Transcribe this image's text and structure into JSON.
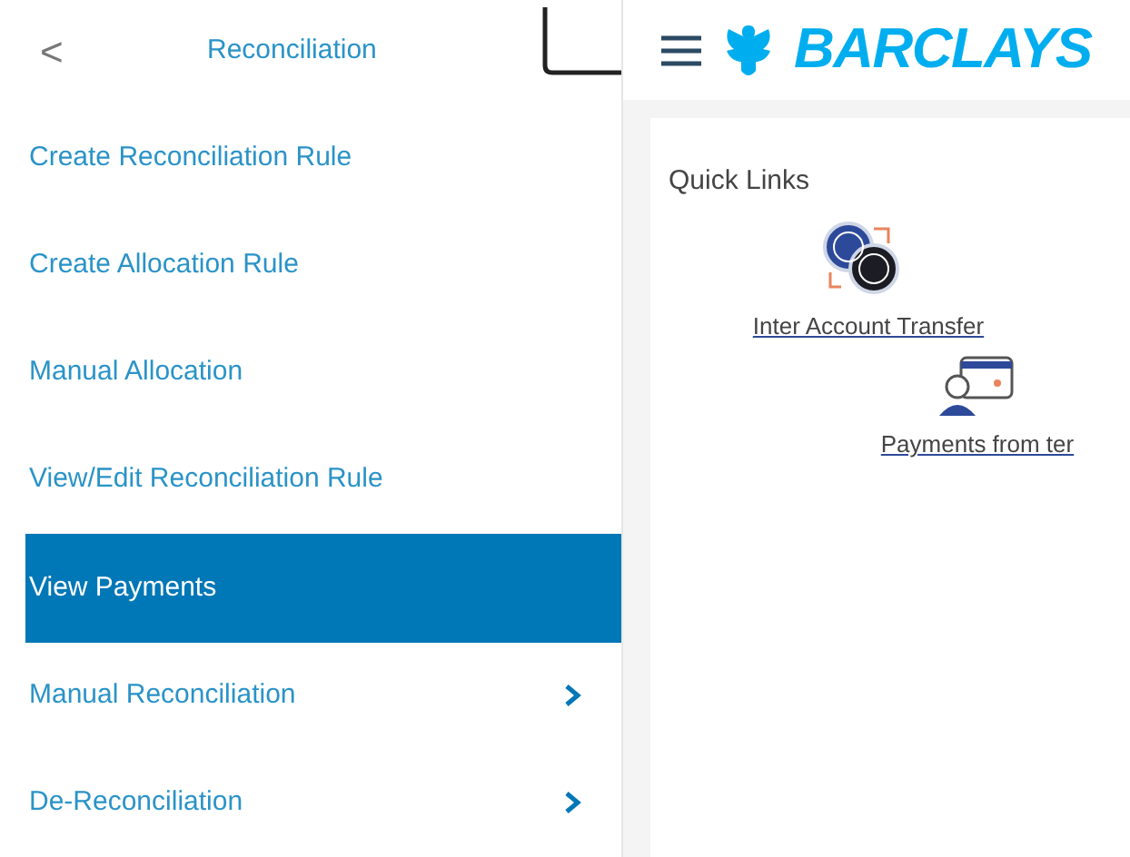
{
  "sidebar": {
    "back": "<",
    "title": "Reconciliation",
    "items": [
      {
        "label": "Create Reconciliation Rule",
        "selected": false,
        "kind": "link"
      },
      {
        "label": "Create Allocation Rule",
        "selected": false,
        "kind": "link"
      },
      {
        "label": "Manual Allocation",
        "selected": false,
        "kind": "link"
      },
      {
        "label": "View/Edit Reconciliation Rule",
        "selected": false,
        "kind": "link"
      },
      {
        "label": "View Payments",
        "selected": true,
        "kind": "link"
      },
      {
        "label": "Manual Reconciliation",
        "selected": false,
        "kind": "submenu"
      },
      {
        "label": "De-Reconciliation",
        "selected": false,
        "kind": "submenu"
      }
    ]
  },
  "header": {
    "brand": "BARCLAYS"
  },
  "quick_links": {
    "title": "Quick Links",
    "links": [
      {
        "label": "Inter Account Transfer",
        "kind": "transfer"
      },
      {
        "label": "Payments from ter",
        "kind": "payments"
      }
    ]
  }
}
